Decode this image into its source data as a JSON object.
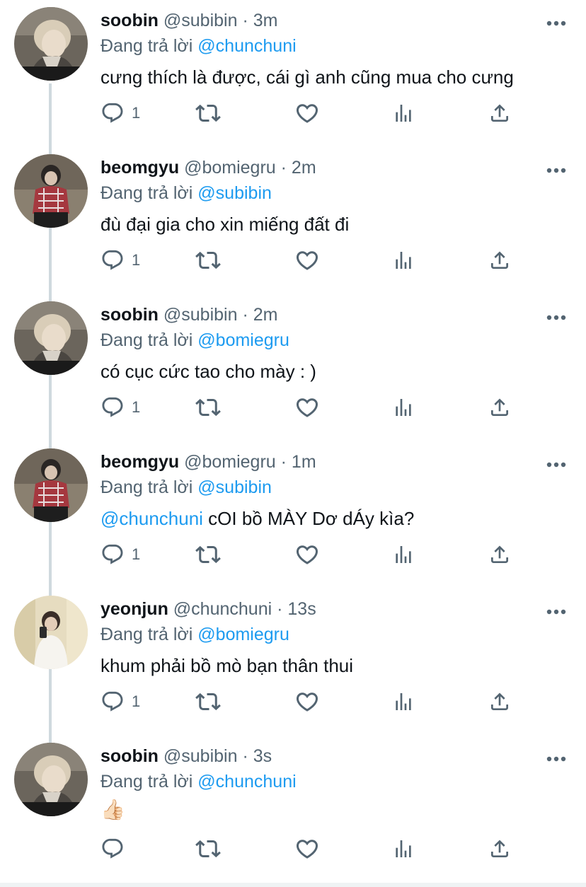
{
  "reply_prefix": "Đang trả lời",
  "colors": {
    "name": "#0f1419",
    "secondary": "#536471",
    "mention": "#1d9bf0",
    "thread_line": "#cfd9de"
  },
  "icons": {
    "reply": "reply-icon",
    "retweet": "retweet-icon",
    "like": "heart-icon",
    "stats": "stats-icon",
    "share": "share-icon",
    "more": "more-icon"
  },
  "tweets": [
    {
      "name": "soobin",
      "handle": "@subibin",
      "sep": "·",
      "time": "3m",
      "reply_to": "@chunchuni",
      "mention_in_text": "",
      "text": "cưng thích là được, cái gì anh cũng mua cho cưng",
      "reply_count": "1",
      "avatar": "soobin-avatar"
    },
    {
      "name": "beomgyu",
      "handle": "@bomiegru",
      "sep": "·",
      "time": "2m",
      "reply_to": "@subibin",
      "mention_in_text": "",
      "text": "đù đại gia cho xin miếng đất đi",
      "reply_count": "1",
      "avatar": "beomgyu-avatar"
    },
    {
      "name": "soobin",
      "handle": "@subibin",
      "sep": "·",
      "time": "2m",
      "reply_to": "@bomiegru",
      "mention_in_text": "",
      "text": "có cục cức tao cho mày : )",
      "reply_count": "1",
      "avatar": "soobin-avatar"
    },
    {
      "name": "beomgyu",
      "handle": "@bomiegru",
      "sep": "·",
      "time": "1m",
      "reply_to": "@subibin",
      "mention_in_text": "@chunchuni",
      "text": " cOI bồ MÀY Dơ dÁy kìa?",
      "reply_count": "1",
      "avatar": "beomgyu-avatar"
    },
    {
      "name": "yeonjun",
      "handle": "@chunchuni",
      "sep": "·",
      "time": "13s",
      "reply_to": "@bomiegru",
      "mention_in_text": "",
      "text": "khum phải bồ mò bạn thân thui",
      "reply_count": "1",
      "avatar": "yeonjun-avatar"
    },
    {
      "name": "soobin",
      "handle": "@subibin",
      "sep": "·",
      "time": "3s",
      "reply_to": "@chunchuni",
      "mention_in_text": "",
      "text": "👍🏻",
      "reply_count": "",
      "avatar": "soobin-avatar"
    }
  ]
}
